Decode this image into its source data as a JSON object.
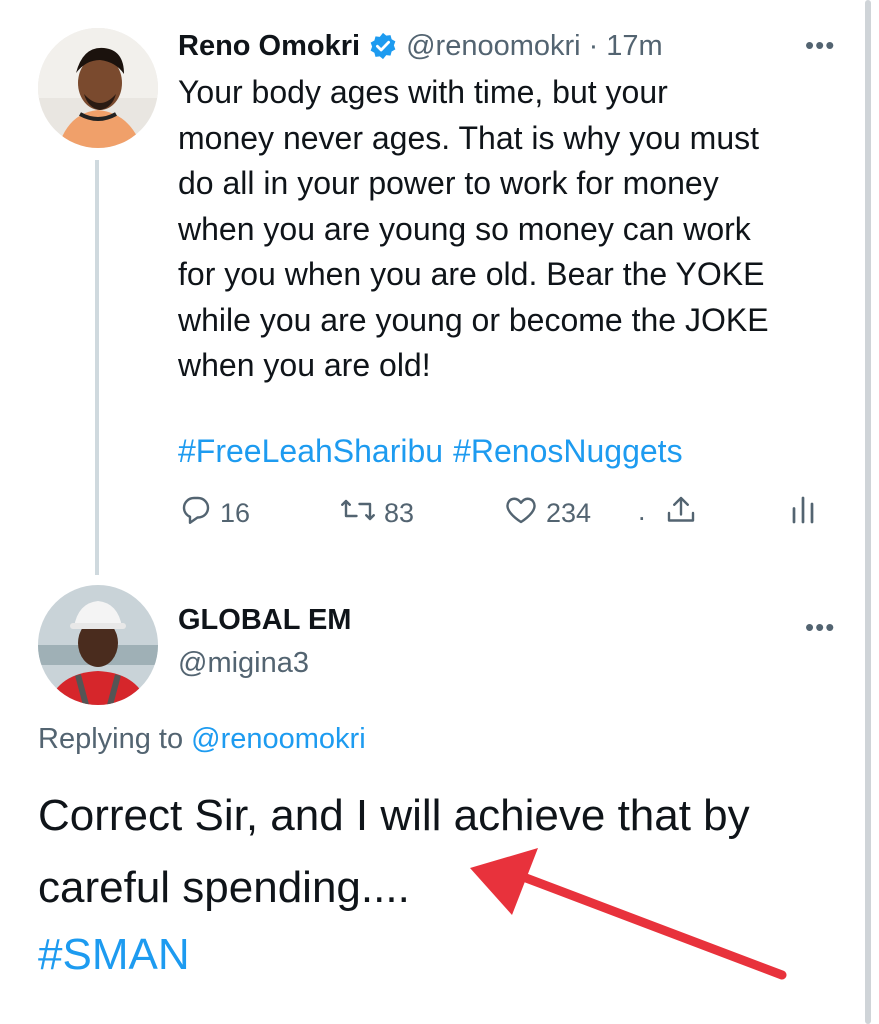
{
  "tweet": {
    "author_name": "Reno Omokri",
    "handle": "@renoomokri",
    "separator": "·",
    "time": "17m",
    "body": "Your body ages with time, but your\nmoney never ages. That is why you must\ndo all in your power to work for money\nwhen you are young so money can work\nfor you when you are old. Bear the YOKE\nwhile you are young or become the JOKE\nwhen you are old!",
    "hashtags": [
      "#FreeLeahSharibu",
      "#RenosNuggets"
    ],
    "replies": "16",
    "retweets": "83",
    "likes": "234",
    "dot": "."
  },
  "reply": {
    "author_name": "GLOBAL EM",
    "handle": "@migina3",
    "replying_prefix": "Replying to",
    "replying_to": "@renoomokri",
    "text_line1": "Correct Sir, and I will achieve that by",
    "text_line2": "careful spending....",
    "hashtag": "#SMAN"
  },
  "more_glyph": "•••",
  "colors": {
    "link": "#1d9bf0",
    "muted": "#536471",
    "text": "#0f1419",
    "annotation_arrow": "#e8323c"
  },
  "icons": [
    "verified-badge-icon",
    "reply-icon",
    "retweet-icon",
    "like-icon",
    "share-icon",
    "analytics-icon",
    "more-icon"
  ]
}
